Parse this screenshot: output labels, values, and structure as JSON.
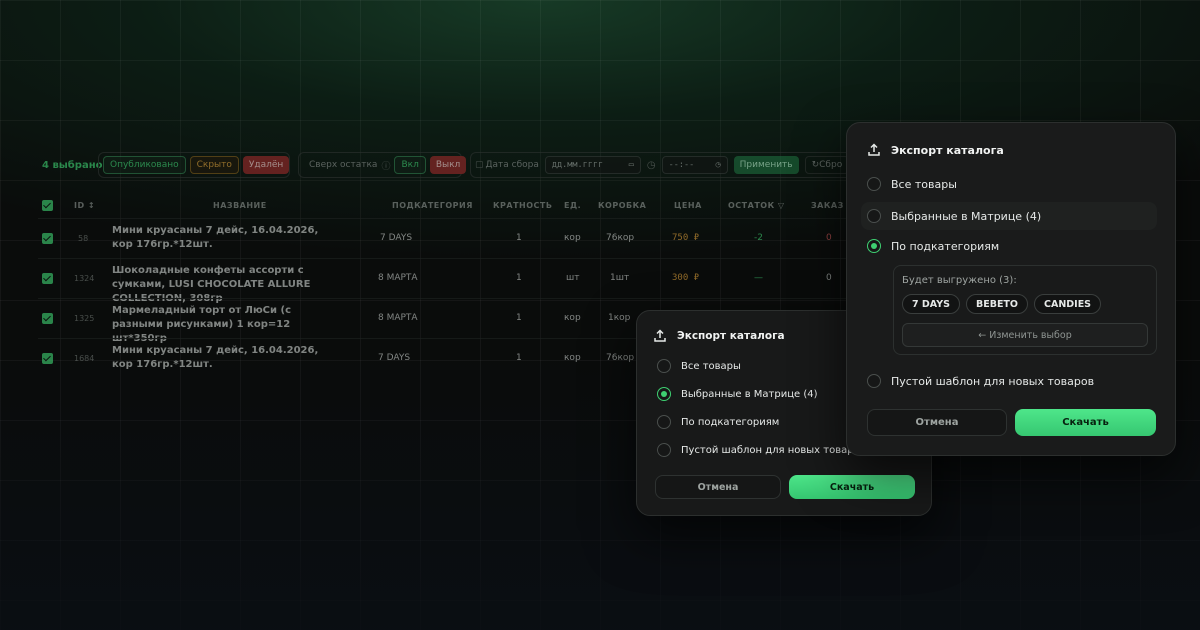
{
  "toolbar": {
    "selected_count": "4 выбрано",
    "published": "Опубликовано",
    "hidden": "Скрыто",
    "deleted": "Удалён",
    "over_stock_label": "Сверх остатка",
    "on": "Вкл",
    "off": "Выкл",
    "date_label": "Дата сбора",
    "date_placeholder": "дд.мм.гггг",
    "time_placeholder": "--:--",
    "apply": "Применить",
    "reset": "Сбро"
  },
  "table": {
    "headers": {
      "id": "ID",
      "name": "НАЗВАНИЕ",
      "subcategory": "ПОДКАТЕГОРИЯ",
      "multiplicity": "КРАТНОСТЬ",
      "unit": "ЕД.",
      "box": "КОРОБКА",
      "price": "ЦЕНА",
      "stock": "ОСТАТОК",
      "order": "ЗАКАЗ"
    },
    "rows": [
      {
        "id": "58",
        "name": "Мини круасаны 7 дейс, 16.04.2026, кор 176гр.*12шт.",
        "subcategory": "7 DAYS",
        "multiplicity": "1",
        "unit": "кор",
        "box": "76кор",
        "price": "750 ₽",
        "stock": "-2",
        "order": "0"
      },
      {
        "id": "1324",
        "name": "Шоколадные конфеты ассорти с сумками, LUSI CHOCOLATE ALLURE COLLECTION, 308гр",
        "subcategory": "8 МАРТА",
        "multiplicity": "1",
        "unit": "шт",
        "box": "1шт",
        "price": "300 ₽",
        "stock": "—",
        "order": "0"
      },
      {
        "id": "1325",
        "name": "Мармеладный торт от ЛюСи (с разными рисунками) 1 кор=12 шт*350гр",
        "subcategory": "8 МАРТА",
        "multiplicity": "1",
        "unit": "кор",
        "box": "1кор",
        "price": "",
        "stock": "",
        "order": ""
      },
      {
        "id": "1684",
        "name": "Мини круасаны 7 дейс, 16.04.2026, кор 176гр.*12шт.",
        "subcategory": "7 DAYS",
        "multiplicity": "1",
        "unit": "кор",
        "box": "76кор",
        "price": "",
        "stock": "",
        "order": ""
      }
    ]
  },
  "modal_small": {
    "title": "Экспорт каталога",
    "options": [
      "Все товары",
      "Выбранные в Матрице (4)",
      "По подкатегориям",
      "Пустой шаблон для новых товаров"
    ],
    "selected_index": 1,
    "cancel": "Отмена",
    "download": "Скачать"
  },
  "modal_large": {
    "title": "Экспорт каталога",
    "options": [
      "Все товары",
      "Выбранные в Матрице (4)",
      "По подкатегориям",
      "Пустой шаблон для новых товаров"
    ],
    "selected_index": 2,
    "export_label": "Будет выгружено (3):",
    "tags": [
      "7 DAYS",
      "BEBETO",
      "CANDIES"
    ],
    "change_selection": "← Изменить выбор",
    "cancel": "Отмена",
    "download": "Скачать"
  },
  "colors": {
    "accent": "#3ecf71",
    "price": "#e0a23a",
    "danger": "#9b2a2a",
    "modal_bg": "#1a1b1b"
  }
}
